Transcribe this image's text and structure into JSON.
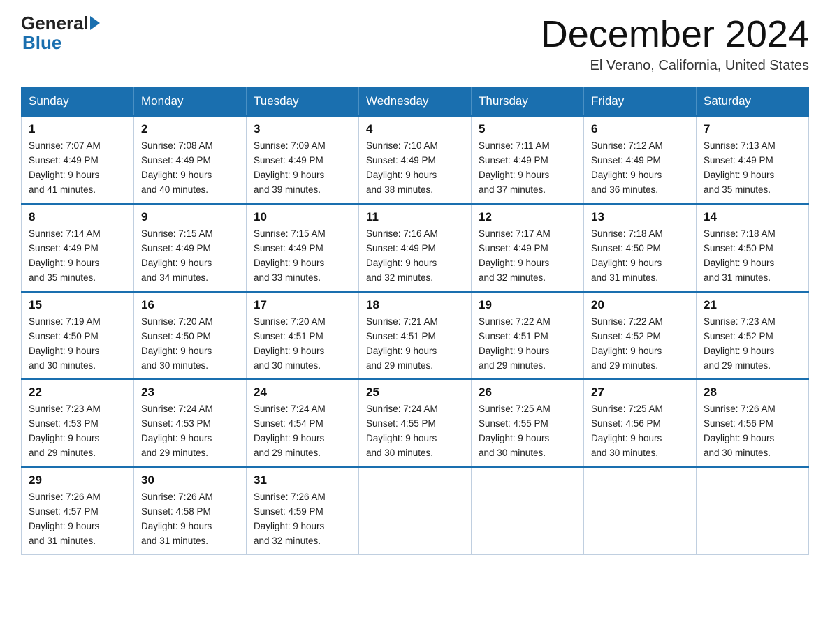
{
  "header": {
    "logo_general": "General",
    "logo_blue": "Blue",
    "month_title": "December 2024",
    "location": "El Verano, California, United States"
  },
  "days_of_week": [
    "Sunday",
    "Monday",
    "Tuesday",
    "Wednesday",
    "Thursday",
    "Friday",
    "Saturday"
  ],
  "weeks": [
    [
      {
        "num": "1",
        "sunrise": "7:07 AM",
        "sunset": "4:49 PM",
        "daylight": "9 hours and 41 minutes."
      },
      {
        "num": "2",
        "sunrise": "7:08 AM",
        "sunset": "4:49 PM",
        "daylight": "9 hours and 40 minutes."
      },
      {
        "num": "3",
        "sunrise": "7:09 AM",
        "sunset": "4:49 PM",
        "daylight": "9 hours and 39 minutes."
      },
      {
        "num": "4",
        "sunrise": "7:10 AM",
        "sunset": "4:49 PM",
        "daylight": "9 hours and 38 minutes."
      },
      {
        "num": "5",
        "sunrise": "7:11 AM",
        "sunset": "4:49 PM",
        "daylight": "9 hours and 37 minutes."
      },
      {
        "num": "6",
        "sunrise": "7:12 AM",
        "sunset": "4:49 PM",
        "daylight": "9 hours and 36 minutes."
      },
      {
        "num": "7",
        "sunrise": "7:13 AM",
        "sunset": "4:49 PM",
        "daylight": "9 hours and 35 minutes."
      }
    ],
    [
      {
        "num": "8",
        "sunrise": "7:14 AM",
        "sunset": "4:49 PM",
        "daylight": "9 hours and 35 minutes."
      },
      {
        "num": "9",
        "sunrise": "7:15 AM",
        "sunset": "4:49 PM",
        "daylight": "9 hours and 34 minutes."
      },
      {
        "num": "10",
        "sunrise": "7:15 AM",
        "sunset": "4:49 PM",
        "daylight": "9 hours and 33 minutes."
      },
      {
        "num": "11",
        "sunrise": "7:16 AM",
        "sunset": "4:49 PM",
        "daylight": "9 hours and 32 minutes."
      },
      {
        "num": "12",
        "sunrise": "7:17 AM",
        "sunset": "4:49 PM",
        "daylight": "9 hours and 32 minutes."
      },
      {
        "num": "13",
        "sunrise": "7:18 AM",
        "sunset": "4:50 PM",
        "daylight": "9 hours and 31 minutes."
      },
      {
        "num": "14",
        "sunrise": "7:18 AM",
        "sunset": "4:50 PM",
        "daylight": "9 hours and 31 minutes."
      }
    ],
    [
      {
        "num": "15",
        "sunrise": "7:19 AM",
        "sunset": "4:50 PM",
        "daylight": "9 hours and 30 minutes."
      },
      {
        "num": "16",
        "sunrise": "7:20 AM",
        "sunset": "4:50 PM",
        "daylight": "9 hours and 30 minutes."
      },
      {
        "num": "17",
        "sunrise": "7:20 AM",
        "sunset": "4:51 PM",
        "daylight": "9 hours and 30 minutes."
      },
      {
        "num": "18",
        "sunrise": "7:21 AM",
        "sunset": "4:51 PM",
        "daylight": "9 hours and 29 minutes."
      },
      {
        "num": "19",
        "sunrise": "7:22 AM",
        "sunset": "4:51 PM",
        "daylight": "9 hours and 29 minutes."
      },
      {
        "num": "20",
        "sunrise": "7:22 AM",
        "sunset": "4:52 PM",
        "daylight": "9 hours and 29 minutes."
      },
      {
        "num": "21",
        "sunrise": "7:23 AM",
        "sunset": "4:52 PM",
        "daylight": "9 hours and 29 minutes."
      }
    ],
    [
      {
        "num": "22",
        "sunrise": "7:23 AM",
        "sunset": "4:53 PM",
        "daylight": "9 hours and 29 minutes."
      },
      {
        "num": "23",
        "sunrise": "7:24 AM",
        "sunset": "4:53 PM",
        "daylight": "9 hours and 29 minutes."
      },
      {
        "num": "24",
        "sunrise": "7:24 AM",
        "sunset": "4:54 PM",
        "daylight": "9 hours and 29 minutes."
      },
      {
        "num": "25",
        "sunrise": "7:24 AM",
        "sunset": "4:55 PM",
        "daylight": "9 hours and 30 minutes."
      },
      {
        "num": "26",
        "sunrise": "7:25 AM",
        "sunset": "4:55 PM",
        "daylight": "9 hours and 30 minutes."
      },
      {
        "num": "27",
        "sunrise": "7:25 AM",
        "sunset": "4:56 PM",
        "daylight": "9 hours and 30 minutes."
      },
      {
        "num": "28",
        "sunrise": "7:26 AM",
        "sunset": "4:56 PM",
        "daylight": "9 hours and 30 minutes."
      }
    ],
    [
      {
        "num": "29",
        "sunrise": "7:26 AM",
        "sunset": "4:57 PM",
        "daylight": "9 hours and 31 minutes."
      },
      {
        "num": "30",
        "sunrise": "7:26 AM",
        "sunset": "4:58 PM",
        "daylight": "9 hours and 31 minutes."
      },
      {
        "num": "31",
        "sunrise": "7:26 AM",
        "sunset": "4:59 PM",
        "daylight": "9 hours and 32 minutes."
      },
      null,
      null,
      null,
      null
    ]
  ],
  "labels": {
    "sunrise": "Sunrise:",
    "sunset": "Sunset:",
    "daylight": "Daylight:"
  }
}
